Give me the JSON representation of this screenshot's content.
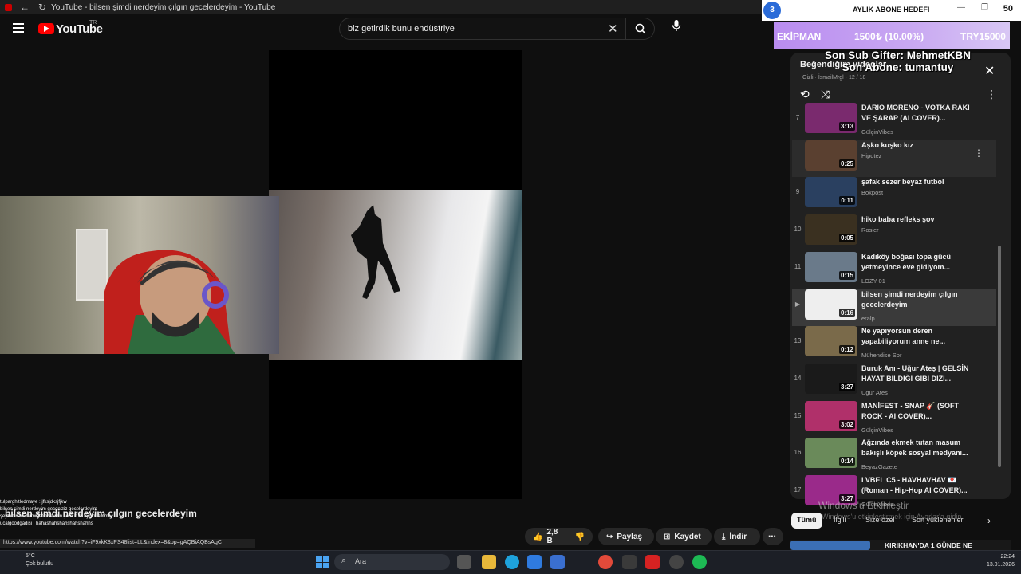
{
  "window": {
    "tab_title": "YouTube - bilsen şimdi nerdeyim çılgın gecelerdeyim - YouTube"
  },
  "header": {
    "logo_text": "YouTube",
    "region": "TR",
    "search_value": "biz getirdik bunu endüstriye"
  },
  "overlay": {
    "goal_badge": "3",
    "goal_label": "AYLIK ABONE HEDEFİ",
    "goal_count": "50",
    "goal_left": "EKİPMAN",
    "goal_mid": "1500₺ (10.00%)",
    "goal_right": "TRY15000",
    "last_gifter": "Son Sub Gifter: MehmetKBN",
    "last_sub": "Son Abone: tumantuy"
  },
  "playlist": {
    "title": "Beğendiğim videolar",
    "subtitle": "Gizli · İsmailMrgl · 12 / 18",
    "items": [
      {
        "idx": "7",
        "title": "DARIO MORENO - VOTKA RAKI VE ŞARAP (AI COVER)...",
        "channel": "GülçinVibes",
        "dur": "3:13"
      },
      {
        "idx": "",
        "title": "Aşko kuşko kız",
        "channel": "Hipotez",
        "dur": "0:25"
      },
      {
        "idx": "9",
        "title": "şafak sezer beyaz futbol",
        "channel": "Bokpost",
        "dur": "0:11"
      },
      {
        "idx": "10",
        "title": "hiko baba refleks şov",
        "channel": "Rosier",
        "dur": "0:05"
      },
      {
        "idx": "11",
        "title": "Kadıköy boğası topa gücü yetmeyince eve gidiyom...",
        "channel": "LOZY 01",
        "dur": "0:15"
      },
      {
        "idx": "▶",
        "title": "bilsen şimdi nerdeyim çılgın gecelerdeyim",
        "channel": "eralp",
        "dur": "0:16"
      },
      {
        "idx": "13",
        "title": "Ne yapıyorsun deren yapabiliyorum anne ne...",
        "channel": "Mühendise Sor",
        "dur": "0:12"
      },
      {
        "idx": "14",
        "title": "Buruk Anı - Uğur Ateş | GELSİN HAYAT BİLDİĞİ GİBİ DİZİ...",
        "channel": "Ugur Ates",
        "dur": "3:27"
      },
      {
        "idx": "15",
        "title": "MANİFEST - SNAP 🎸 (SOFT ROCK - AI COVER)...",
        "channel": "GülçinVibes",
        "dur": "3:02"
      },
      {
        "idx": "16",
        "title": "Ağzında ekmek tutan masum bakışlı köpek sosyal medyanı...",
        "channel": "BeyazGazete",
        "dur": "0:14"
      },
      {
        "idx": "17",
        "title": "LVBEL C5 - HAVHAVHAV 💌 (Roman - Hip-Hop AI COVER)...",
        "channel": "GülçinVibes",
        "dur": "3:27"
      }
    ]
  },
  "chips": {
    "all": "Tümü",
    "related": "İlgili",
    "for_you": "Size özel",
    "recent": "Son yüklenenler"
  },
  "next_video": "KIRIKHAN'DA 1 GÜNDE NE",
  "actions": {
    "likes": "2,8 B",
    "share": "Paylaş",
    "save": "Kaydet",
    "download": "İndir"
  },
  "watermark": {
    "line1": "Windows'u Etkinleştir",
    "line2": "Windows'u etkinleştirmek için Ayarlar'a gidin."
  },
  "chat": {
    "lines": [
      "tulparghitledmaye : jfksjdksjfjkw",
      "bilsen şimdi nerdeyim geceniziz gecelerdeyim",
      "şeytanın ve hammatin ve min şerri kulli aynin lamme",
      "ucalgoodgadisi : hahashahshahshahshahhs"
    ],
    "big_text": "bilsen şimdi nerdeyim çılgın gecelerdeyim"
  },
  "status_url": "https://www.youtube.com/watch?v=iF9xkK8xPS48list=LL&index=8&pp=gAQBiAQBsAgC",
  "taskbar": {
    "weather_temp": "5°C",
    "weather_desc": "Çok bulutlu",
    "search": "Ara",
    "time": "22:24",
    "date": "13.01.2026"
  }
}
